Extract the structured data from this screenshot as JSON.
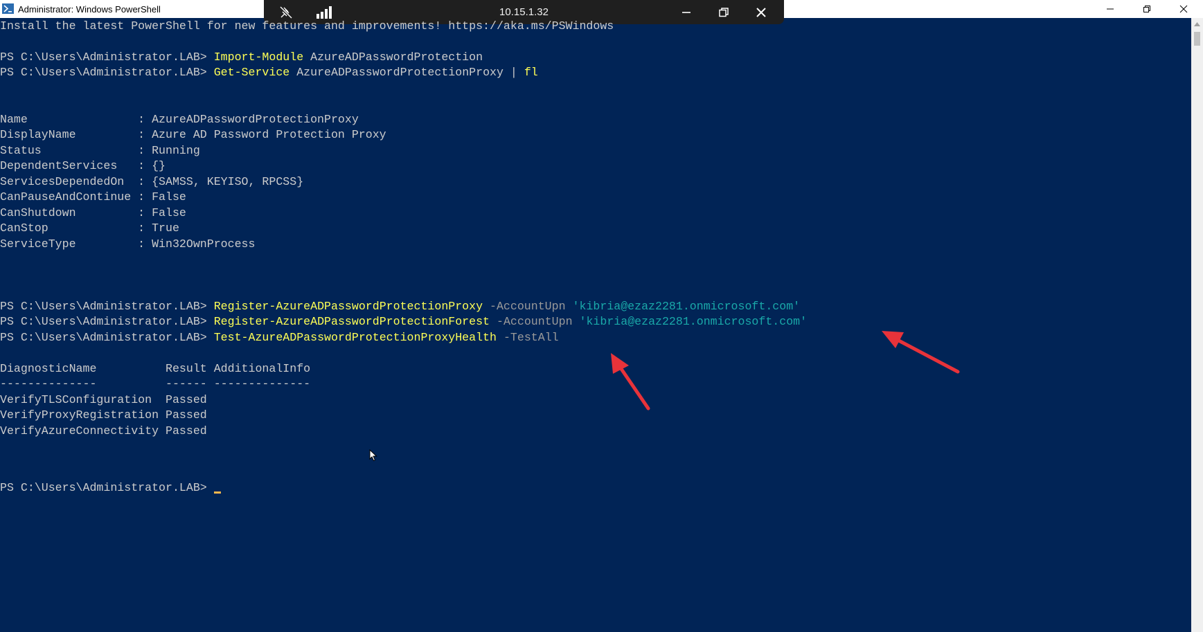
{
  "window": {
    "title": "Administrator: Windows PowerShell",
    "icons": [
      "powershell-icon",
      "minimize-icon",
      "restore-icon",
      "close-icon"
    ]
  },
  "rdp": {
    "ip": "10.15.1.32",
    "icons": [
      "pin-icon",
      "signal-icon",
      "minimize-icon",
      "restore-icon",
      "close-icon"
    ]
  },
  "console": {
    "banner": "Install the latest PowerShell for new features and improvements! https://aka.ms/PSWindows",
    "prompt": "PS C:\\Users\\Administrator.LAB> ",
    "cmd1": {
      "name": "Import-Module",
      "args": " AzureADPasswordProtection"
    },
    "cmd2": {
      "name": "Get-Service",
      "args": " AzureADPasswordProtectionProxy | ",
      "pipe": "fl"
    },
    "service_props": [
      "Name                : AzureADPasswordProtectionProxy",
      "DisplayName         : Azure AD Password Protection Proxy",
      "Status              : Running",
      "DependentServices   : {}",
      "ServicesDependedOn  : {SAMSS, KEYISO, RPCSS}",
      "CanPauseAndContinue : False",
      "CanShutdown         : False",
      "CanStop             : True",
      "ServiceType         : Win32OwnProcess"
    ],
    "cmd3": {
      "name": "Register-AzureADPasswordProtectionProxy",
      "param": " -AccountUpn ",
      "value": "'kibria@ezaz2281.onmicrosoft.com'"
    },
    "cmd4": {
      "name": "Register-AzureADPasswordProtectionForest",
      "param": " -AccountUpn ",
      "value": "'kibria@ezaz2281.onmicrosoft.com'"
    },
    "cmd5": {
      "name": "Test-AzureADPasswordProtectionProxyHealth",
      "param": " -TestAll"
    },
    "diag_header": "DiagnosticName          Result AdditionalInfo",
    "diag_sep": "--------------          ------ --------------",
    "diag_rows": [
      "VerifyTLSConfiguration  Passed",
      "VerifyProxyRegistration Passed",
      "VerifyAzureConnectivity Passed"
    ]
  },
  "colors": {
    "background": "#012456",
    "text": "#cccccc",
    "command": "#ffff55",
    "parameter": "#9a9a9a",
    "string": "#1aa9a9",
    "annotation_arrow": "#e8333a"
  }
}
